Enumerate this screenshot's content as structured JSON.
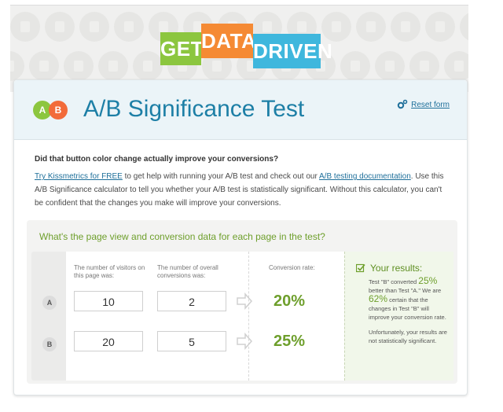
{
  "logo": {
    "word1": "GET",
    "word2": "DATA",
    "word3": "DRIVEN"
  },
  "header": {
    "icon_a": "A",
    "icon_b": "B",
    "title": "A/B Significance Test",
    "reset_label": "Reset form"
  },
  "intro": {
    "question": "Did that button color change actually improve your conversions?",
    "link1": "Try Kissmetrics for FREE",
    "text1": " to get help with running your A/B test and check out our ",
    "link2": "A/B testing documentation",
    "text2": ". Use this A/B Significance calculator to tell you whether your A/B test is statistically significant. Without this calculator, you can't be confident that the changes you make will improve your conversions."
  },
  "form": {
    "question": "What's the page view and conversion data for each page in the test?",
    "col_visitors": "The number of visitors on this page was:",
    "col_conversions": "The number of overall conversions was:",
    "col_rate": "Conversion rate:",
    "rows": [
      {
        "label": "A",
        "visitors": "10",
        "conversions": "2",
        "rate": "20%"
      },
      {
        "label": "B",
        "visitors": "20",
        "conversions": "5",
        "rate": "25%"
      }
    ]
  },
  "results": {
    "title": "Your results:",
    "t1": "Test \"B\" converted ",
    "pct1": "25%",
    "t2": " better than Test \"A.\" We are ",
    "pct2": "62%",
    "t3": " certain that the changes in Test \"B\" will improve your conversion rate.",
    "t4": "Unfortunately, your results are not statistically significant."
  },
  "colors": {
    "accent_green": "#6e9f2c",
    "title_blue": "#1d7fa6",
    "logo_green": "#8cc63f",
    "logo_orange": "#f58a34",
    "logo_blue": "#3fb7dd"
  },
  "icons": [
    "gear-icon",
    "arrow-right-icon",
    "checkbox-icon"
  ]
}
